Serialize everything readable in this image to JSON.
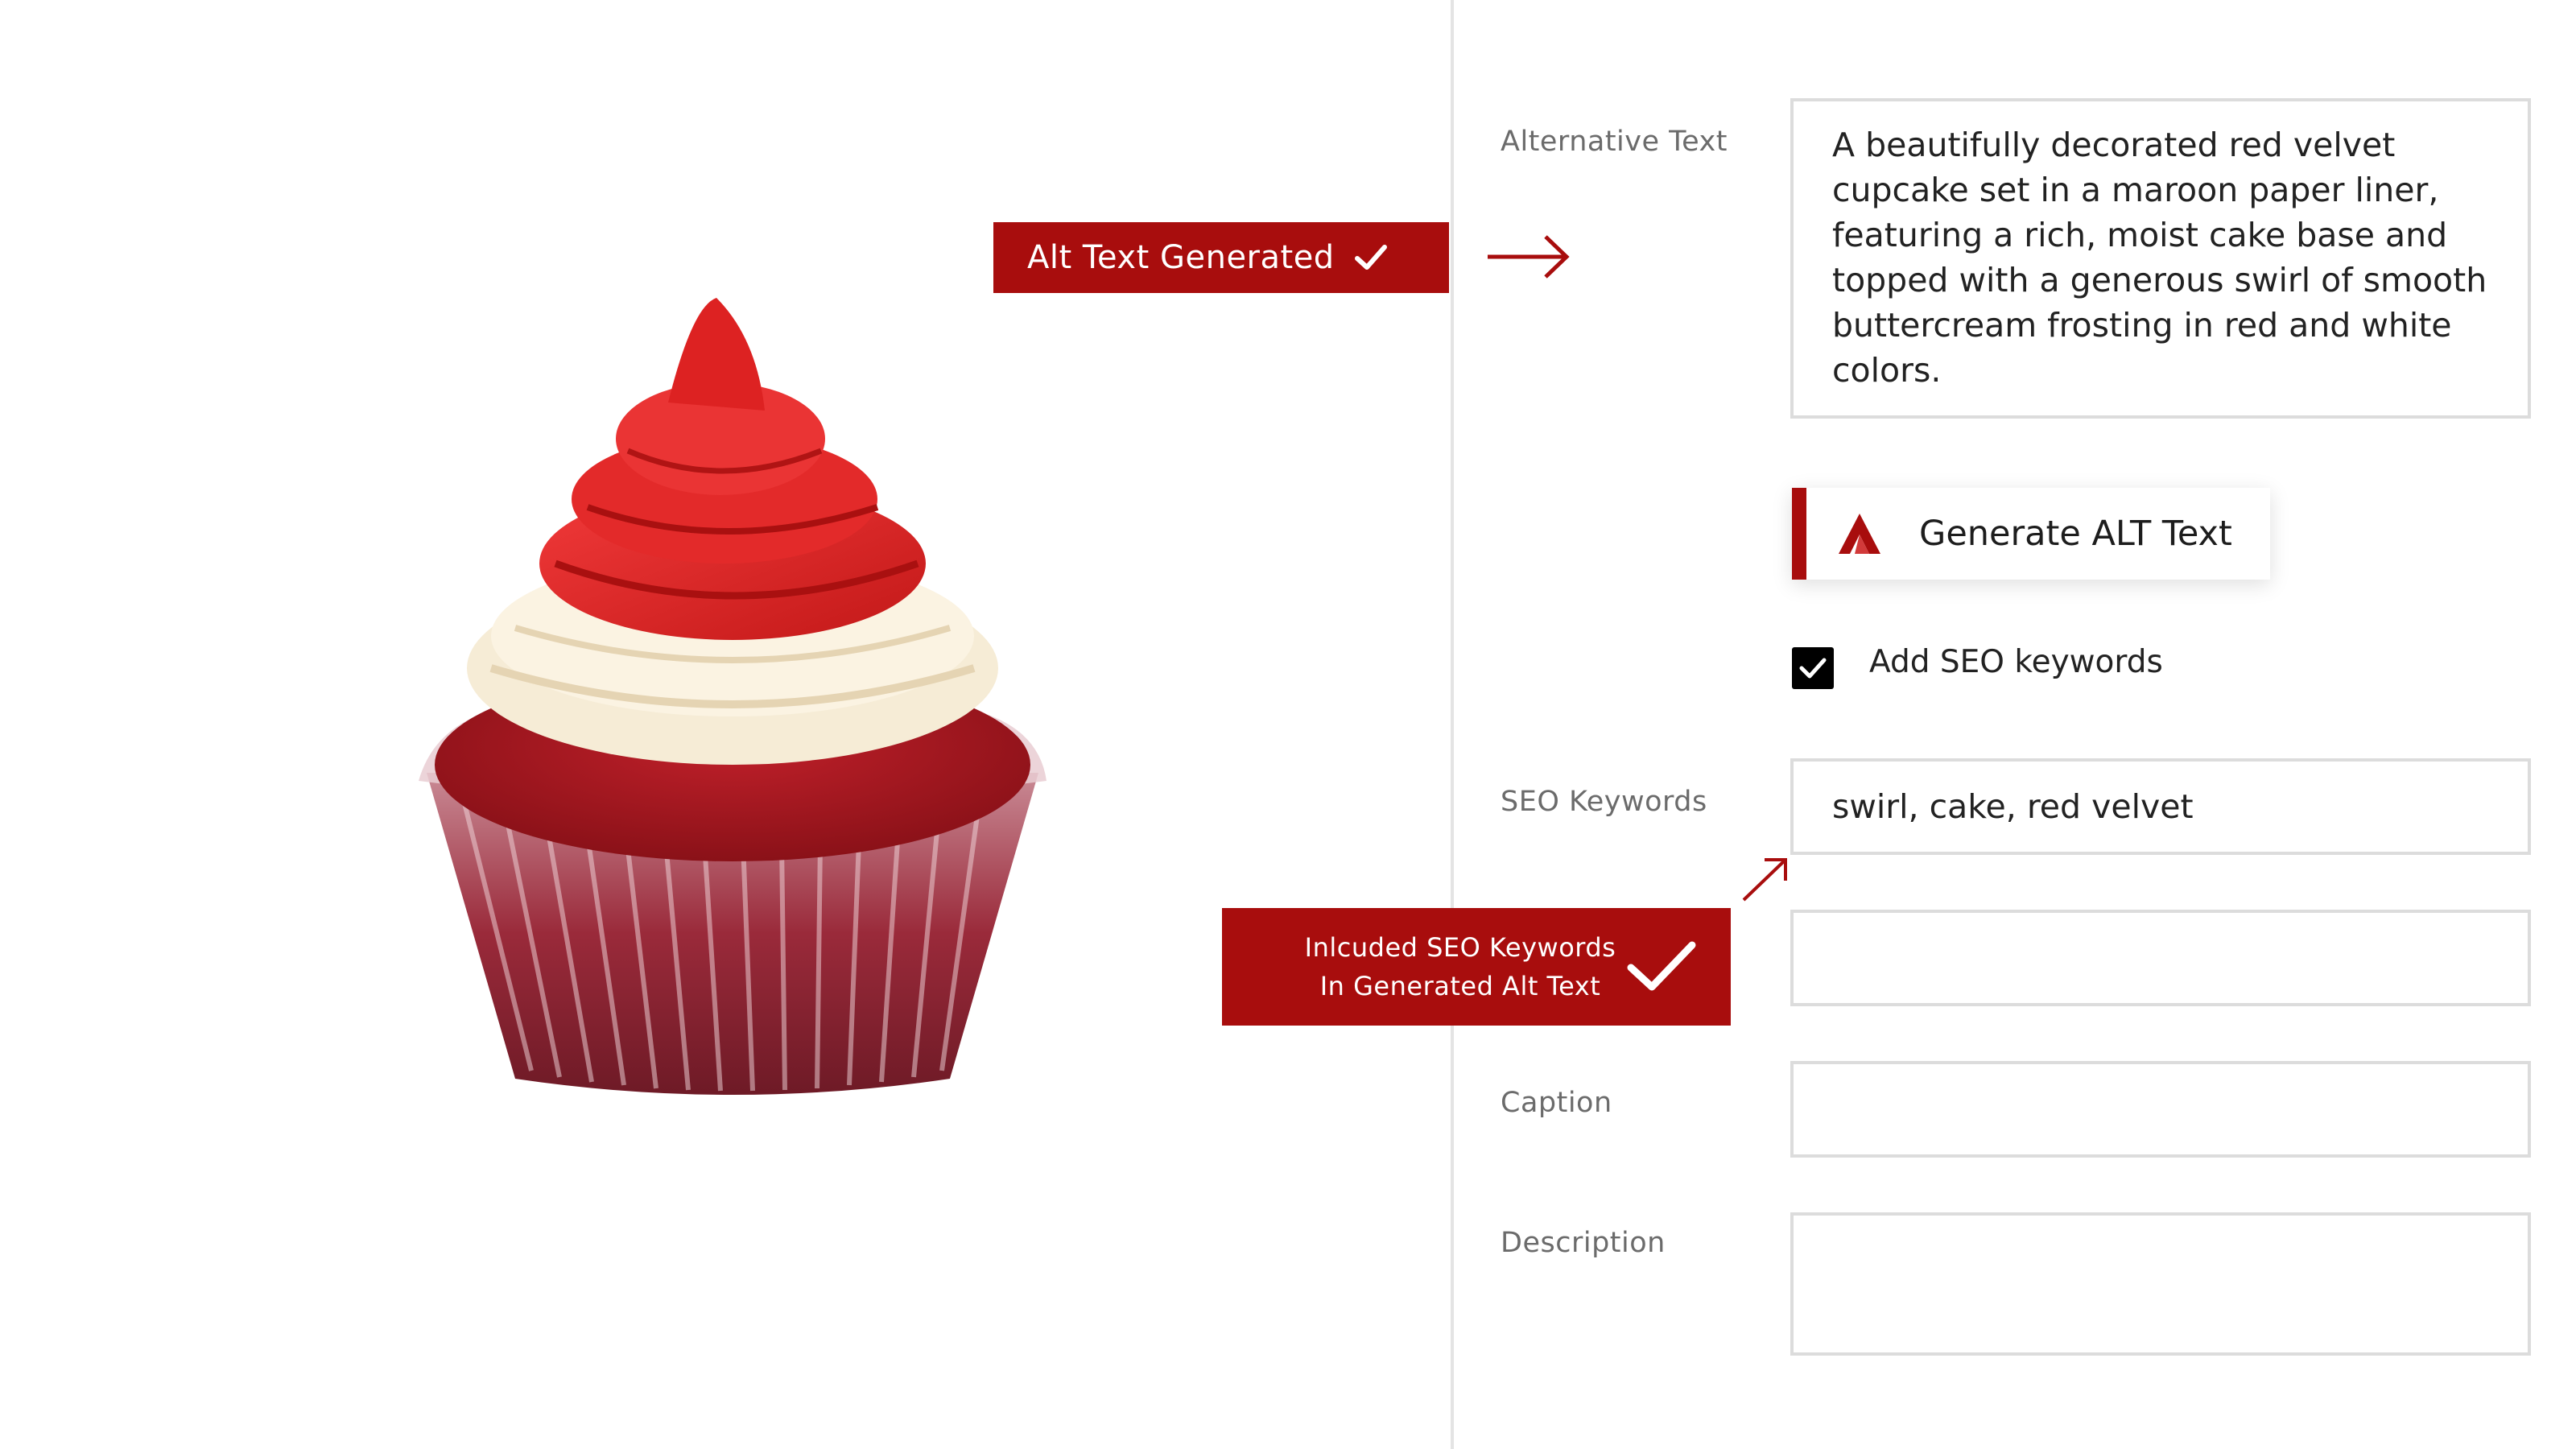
{
  "callouts": {
    "alt_generated": "Alt Text Generated",
    "seo_line1": "Inlcuded SEO Keywords",
    "seo_line2": "In Generated Alt Text"
  },
  "form": {
    "alt_text_label": "Alternative Text",
    "alt_text_value": "A beautifully decorated red velvet cupcake set in a maroon paper liner, featuring a rich, moist cake base and topped with a generous swirl of smooth buttercream frosting in red and white colors.",
    "generate_button_label": "Generate ALT Text",
    "seo_checkbox_label": "Add SEO keywords",
    "seo_checkbox_checked": true,
    "seo_keywords_label": "SEO Keywords",
    "seo_keywords_value": "swirl, cake, red velvet",
    "caption_label": "Caption",
    "caption_value": "",
    "description_label": "Description",
    "description_value": ""
  },
  "icons": {
    "check": "check-icon",
    "arrow": "arrow-right-icon",
    "logo": "app-logo-icon"
  },
  "colors": {
    "accent": "#a80d0d",
    "border": "#dcdcdc",
    "label": "#6b6b6b"
  }
}
